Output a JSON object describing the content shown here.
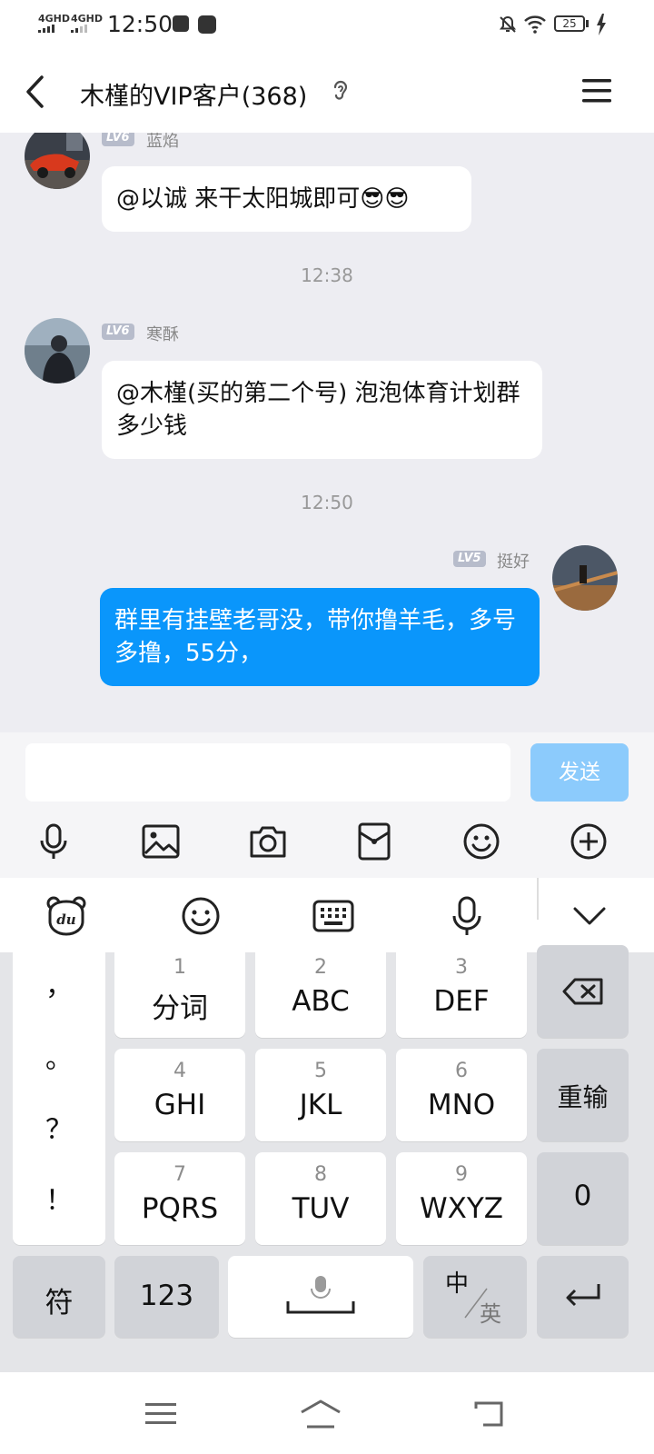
{
  "status_bar": {
    "time": "12:50",
    "signal_1": "4GHD",
    "signal_2": "4GHD",
    "battery": "25"
  },
  "header": {
    "title": "木槿的VIP客户(368)"
  },
  "messages": [
    {
      "level": "LV6",
      "nickname": "蓝焰",
      "text": "@以诚 来干太阳城即可😎😎"
    },
    {
      "timestamp": "12:38"
    },
    {
      "level": "LV6",
      "nickname": "寒酥",
      "text": "@木槿(买的第二个号) 泡泡体育计划群多少钱"
    },
    {
      "timestamp": "12:50"
    },
    {
      "level": "LV5",
      "nickname": "挺好",
      "text": "群里有挂壁老哥没，带你撸羊毛，多号多撸，55分，",
      "self": true
    }
  ],
  "input": {
    "value": "",
    "placeholder": "",
    "send_label": "发送"
  },
  "keyboard": {
    "left_punct": [
      "，",
      "。",
      "？",
      "！"
    ],
    "keys": [
      {
        "num": "1",
        "label": "分词"
      },
      {
        "num": "2",
        "label": "ABC"
      },
      {
        "num": "3",
        "label": "DEF"
      },
      {
        "num": "4",
        "label": "GHI"
      },
      {
        "num": "5",
        "label": "JKL"
      },
      {
        "num": "6",
        "label": "MNO"
      },
      {
        "num": "7",
        "label": "PQRS"
      },
      {
        "num": "8",
        "label": "TUV"
      },
      {
        "num": "9",
        "label": "WXYZ"
      }
    ],
    "reinput_label": "重输",
    "zero_label": "0",
    "symbol_label": "符",
    "num_label": "123",
    "lang_zh": "中",
    "lang_en": "英"
  },
  "colors": {
    "accent": "#0a96fb",
    "send_disabled": "#8ccbfc",
    "chat_bg": "#ededf2"
  }
}
